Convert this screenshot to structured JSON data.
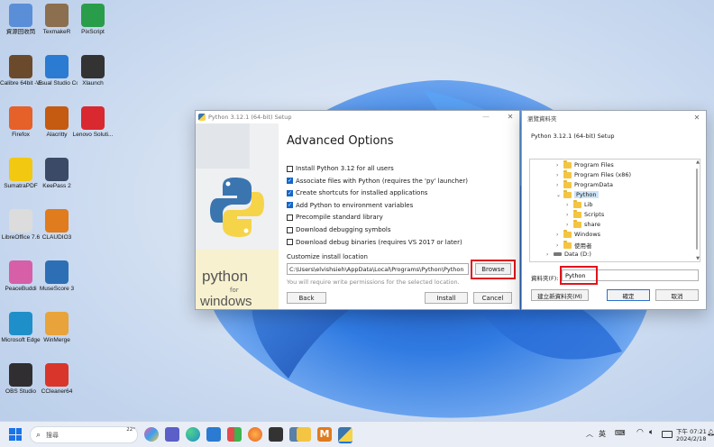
{
  "desktop": {
    "icons": [
      {
        "label": "資源回收筒",
        "icon": "recycle-bin-icon",
        "color": "#5a8fd8"
      },
      {
        "label": "TexmakeR",
        "icon": "texmaker-icon",
        "color": "#8b6f4e"
      },
      {
        "label": "PixScript",
        "icon": "pixscript-icon",
        "color": "#2a9d4b"
      },
      {
        "label": "Calibre 64bit - E-book",
        "icon": "calibre-icon",
        "color": "#6b4a2b"
      },
      {
        "label": "Visual Studio Code",
        "icon": "vscode-icon",
        "color": "#2a7bd1"
      },
      {
        "label": "Xlaunch",
        "icon": "xlaunch-icon",
        "color": "#333333"
      },
      {
        "label": "Firefox",
        "icon": "firefox-icon",
        "color": "#e6602a"
      },
      {
        "label": "Alacritty",
        "icon": "alacritty-icon",
        "color": "#c55a11"
      },
      {
        "label": "Lenovo Soluti...",
        "icon": "lenovo-icon",
        "color": "#d9282f"
      },
      {
        "label": "SumatraPDF",
        "icon": "sumatrapdf-icon",
        "color": "#f2c811"
      },
      {
        "label": "KeePass 2",
        "icon": "keepass-icon",
        "color": "#3b4a66"
      },
      {
        "label": "LibreOffice 7.6",
        "icon": "libreoffice-icon",
        "color": "#dcdcdc"
      },
      {
        "label": "CLAUDIO3",
        "icon": "mathsys-icon",
        "color": "#e07b1e"
      },
      {
        "label": "PeaceBuddi",
        "icon": "lotus-icon",
        "color": "#d65fa8"
      },
      {
        "label": "MuseScore 3",
        "icon": "musescore-icon",
        "color": "#2d6fb5"
      },
      {
        "label": "Microsoft Edge",
        "icon": "edge-icon",
        "color": "#1f8fc9"
      },
      {
        "label": "WinMerge",
        "icon": "winmerge-icon",
        "color": "#e8a33a"
      },
      {
        "label": "OBS Studio",
        "icon": "obs-icon",
        "color": "#302e31"
      },
      {
        "label": "CCleaner64",
        "icon": "ccleaner-icon",
        "color": "#d9352b"
      }
    ]
  },
  "setup": {
    "title": "Python 3.12.1 (64-bit) Setup",
    "heading": "Advanced Options",
    "options": [
      {
        "label": "Install Python 3.12 for all users",
        "checked": false
      },
      {
        "label": "Associate files with Python (requires the 'py' launcher)",
        "checked": true
      },
      {
        "label": "Create shortcuts for installed applications",
        "checked": true
      },
      {
        "label": "Add Python to environment variables",
        "checked": true
      },
      {
        "label": "Precompile standard library",
        "checked": false
      },
      {
        "label": "Download debugging symbols",
        "checked": false
      },
      {
        "label": "Download debug binaries (requires VS 2017 or later)",
        "checked": false
      }
    ],
    "location_label": "Customize install location",
    "location_value": "C:\\Users\\elvishsieh\\AppData\\Local\\Programs\\Python\\Python",
    "browse_label": "Browse",
    "permission_note": "You will require write permissions for the selected location.",
    "back_label": "Back",
    "install_label": "Install",
    "cancel_label": "Cancel",
    "banner_word1": "python",
    "banner_word2": "for",
    "banner_word3": "windows"
  },
  "folder_dialog": {
    "title": "瀏覽資料夾",
    "description": "Python 3.12.1 (64-bit) Setup",
    "tree": [
      {
        "label": "Program Files",
        "indent": 1,
        "expand": "›"
      },
      {
        "label": "Program Files (x86)",
        "indent": 1,
        "expand": "›"
      },
      {
        "label": "ProgramData",
        "indent": 1,
        "expand": "›"
      },
      {
        "label": "Python",
        "indent": 1,
        "expand": "⌄",
        "selected": true
      },
      {
        "label": "Lib",
        "indent": 2,
        "expand": "›"
      },
      {
        "label": "Scripts",
        "indent": 2,
        "expand": "›"
      },
      {
        "label": "share",
        "indent": 2,
        "expand": "›"
      },
      {
        "label": "Windows",
        "indent": 1,
        "expand": "›"
      },
      {
        "label": "使用者",
        "indent": 1,
        "expand": "›"
      },
      {
        "label": "Data (D:)",
        "indent": 0,
        "expand": "›",
        "drive": true
      }
    ],
    "folder_label": "資料夾(F):",
    "folder_value": "Python",
    "new_folder_label": "建立新資料夾(M)",
    "ok_label": "確定",
    "cancel_label": "取消"
  },
  "taskbar": {
    "search_placeholder": "搜尋",
    "weather_temp": "22°",
    "language": "英",
    "time": "下午 07:21",
    "date": "2024/2/18"
  }
}
